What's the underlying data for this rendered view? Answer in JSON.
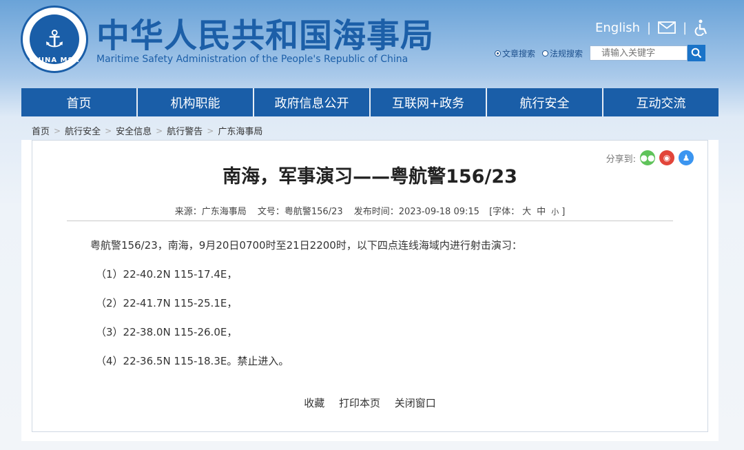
{
  "header": {
    "logo_text": "CHINA MSA",
    "title_cn": "中华人民共和国海事局",
    "title_en": "Maritime Safety Administration of the People's Republic of China",
    "english_link": "English",
    "search": {
      "option1": "文章搜索",
      "option2": "法规搜索",
      "placeholder": "请输入关键字"
    }
  },
  "nav": {
    "items": [
      "首页",
      "机构职能",
      "政府信息公开",
      "互联网+政务",
      "航行安全",
      "互动交流"
    ]
  },
  "breadcrumb": [
    "首页",
    "航行安全",
    "安全信息",
    "航行警告",
    "广东海事局"
  ],
  "share": {
    "label": "分享到:"
  },
  "article": {
    "title": "南海，军事演习——粤航警156/23",
    "meta": {
      "source": "来源：广东海事局",
      "doc_no": "文号：粤航警156/23",
      "published": "发布时间：2023-09-18 09:15",
      "font_label": "[字体：",
      "font_large": "大",
      "font_medium": "中",
      "font_small": "小",
      "font_close": "]"
    },
    "paragraphs": [
      "粤航警156/23，南海，9月20日0700时至21日2200时，以下四点连线海域内进行射击演习：",
      "（1）22-40.2N 115-17.4E，",
      "（2）22-41.7N 115-25.1E，",
      "（3）22-38.0N 115-26.0E，",
      "（4）22-36.5N 115-18.3E。禁止进入。"
    ],
    "actions": [
      "收藏",
      "打印本页",
      "关闭窗口"
    ]
  }
}
